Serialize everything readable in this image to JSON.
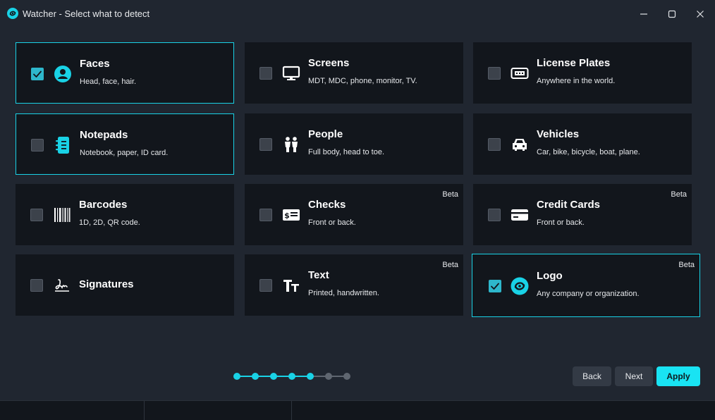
{
  "window": {
    "title": "Watcher - Select what to detect",
    "controls": [
      "minimize",
      "maximize",
      "close"
    ]
  },
  "colors": {
    "accent": "#19d2e6",
    "background": "#202630",
    "card": "#12161c",
    "checked": "#2eb7cc"
  },
  "cards": [
    {
      "label": "Faces",
      "description": "Head, face, hair.",
      "icon": "face-icon",
      "checked": true,
      "selected": true,
      "badge": ""
    },
    {
      "label": "Screens",
      "description": "MDT, MDC, phone, monitor, TV.",
      "icon": "monitor-icon",
      "checked": false,
      "selected": false,
      "badge": ""
    },
    {
      "label": "License Plates",
      "description": "Anywhere in the world.",
      "icon": "license-plate-icon",
      "checked": false,
      "selected": false,
      "badge": ""
    },
    {
      "label": "Notepads",
      "description": "Notebook, paper, ID card.",
      "icon": "notepad-icon",
      "checked": false,
      "selected": true,
      "badge": ""
    },
    {
      "label": "People",
      "description": "Full body, head to toe.",
      "icon": "people-icon",
      "checked": false,
      "selected": false,
      "badge": ""
    },
    {
      "label": "Vehicles",
      "description": "Car, bike, bicycle, boat, plane.",
      "icon": "car-icon",
      "checked": false,
      "selected": false,
      "badge": ""
    },
    {
      "label": "Barcodes",
      "description": "1D, 2D, QR code.",
      "icon": "barcode-icon",
      "checked": false,
      "selected": false,
      "badge": ""
    },
    {
      "label": "Checks",
      "description": "Front or back.",
      "icon": "check-money-icon",
      "checked": false,
      "selected": false,
      "badge": "Beta"
    },
    {
      "label": "Credit Cards",
      "description": "Front or back.",
      "icon": "credit-card-icon",
      "checked": false,
      "selected": false,
      "badge": "Beta"
    },
    {
      "label": "Signatures",
      "description": "",
      "icon": "signature-icon",
      "checked": false,
      "selected": false,
      "badge": ""
    },
    {
      "label": "Text",
      "description": "Printed, handwritten.",
      "icon": "text-icon",
      "checked": false,
      "selected": false,
      "badge": "Beta"
    },
    {
      "label": "Logo",
      "description": "Any company or organization.",
      "icon": "logo-icon",
      "checked": true,
      "selected": true,
      "badge": "Beta"
    }
  ],
  "stepper": {
    "total": 7,
    "completed": 5
  },
  "buttons": {
    "back": "Back",
    "next": "Next",
    "apply": "Apply"
  }
}
